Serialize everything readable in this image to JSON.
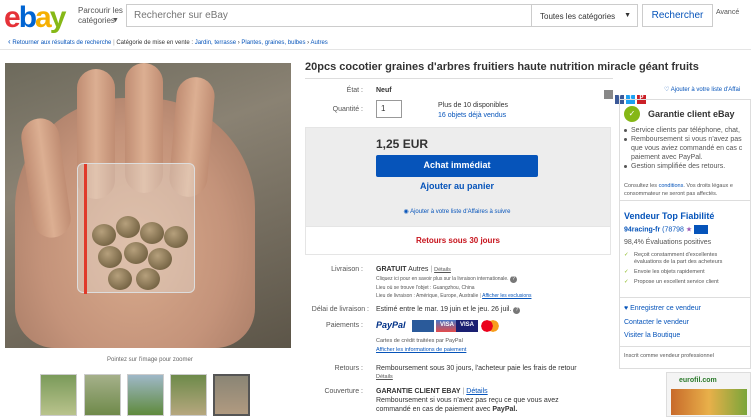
{
  "header": {
    "logo": [
      "e",
      "b",
      "a",
      "y"
    ],
    "browse_label": "Parcourir les catégories",
    "search_placeholder": "Rechercher sur eBay",
    "category_selected": "Toutes les catégories",
    "search_button": "Rechercher",
    "advanced": "Avancé"
  },
  "breadcrumb": {
    "back": "Retourner aux résultats de recherche",
    "category_prefix": "Catégorie de mise en vente :",
    "items": [
      "Jardin, terrasse",
      "Plantes, graines, bulbes",
      "Autres"
    ]
  },
  "gallery": {
    "zoom_hint": "Pointez sur l'image pour zoomer"
  },
  "item": {
    "title": "20pcs cocotier graines d'arbres fruitiers haute nutrition miracle géant fruits",
    "condition_label": "État :",
    "condition_value": "Neuf",
    "quantity_label": "Quantité :",
    "quantity_value": "1",
    "available": "Plus de 10 disponibles",
    "sold": "16 objets déjà vendus",
    "price": "1,25 EUR",
    "buy_now": "Achat immédiat",
    "add_to_cart": "Ajouter au panier",
    "add_watch": "Ajouter à votre liste d'Affaires à suivre",
    "returns": "Retours sous 30 jours"
  },
  "details": {
    "shipping_label": "Livraison :",
    "shipping_value": "GRATUIT",
    "shipping_other": "Autres",
    "shipping_details": "Détails",
    "shipping_note": "Cliquez ici pour en savoir plus sur la livraison internationale.",
    "item_location": "Lieu où se trouve l'objet : Guangzhou, China",
    "ships_to": "Lieu de livraison : Amérique, Europe, Australie",
    "exclusions": "Afficher les exclusions",
    "delivery_label": "Délai de livraison :",
    "delivery_value": "Estimé entre le mar. 19 juin et le jeu. 26 juil.",
    "payments_label": "Paiements :",
    "paypal": "PayPal",
    "payment_logos": [
      "",
      "VISA",
      ""
    ],
    "paypal_note": "Cartes de crédit traitées par PayPal",
    "payment_info": "Afficher les informations de paiement",
    "returns_label": "Retours :",
    "returns_value": "Remboursement sous 30 jours, l'acheteur paie les frais de retour",
    "returns_details": "Détails",
    "coverage_label": "Couverture :",
    "coverage_title": "GARANTIE CLIENT EBAY",
    "coverage_details": "Détails",
    "coverage_text1": "Remboursement si vous n'avez pas reçu ce que vous avez",
    "coverage_text2": "commandé en cas de paiement avec",
    "coverage_paypal": "PayPal."
  },
  "sidebar": {
    "watch_link": "Ajouter à votre liste d'Affai",
    "share_icons": [
      "",
      "f",
      "t",
      "P",
      ""
    ],
    "guarantee_title": "Garantie client eBay",
    "guarantee_bullets": [
      "Service clients par téléphone, chat,",
      "Remboursement si vous n'avez pas",
      "que vous aviez commandé en cas c",
      "paiement avec PayPal.",
      "Gestion simplifiée des retours."
    ],
    "conditions_1": "Consultez les",
    "conditions_link": "conditions",
    "conditions_2": ". Vos droits légaux e",
    "conditions_3": "consommateur ne seront pas affectés.",
    "seller_title": "Vendeur Top Fiabilité",
    "seller_name": "94racing-fr",
    "seller_score": "(78798",
    "seller_rating": "98,4% Évaluations positives",
    "seller_bullets": [
      "Reçoit constamment d'excellentes évaluations de la part des acheteurs",
      "Envoie les objets rapidement",
      "Propose un excellent service client"
    ],
    "save_seller": "Enregistrer ce vendeur",
    "contact_seller": "Contacter le vendeur",
    "visit_shop": "Visiter la Boutique",
    "registered": "Inscrit comme vendeur professionnel"
  },
  "ad": {
    "brand": "eurofil.com"
  },
  "colors": {
    "brand_blue": "#0654ba",
    "returns_red": "#c7131c",
    "guarantee_green": "#85b716"
  }
}
